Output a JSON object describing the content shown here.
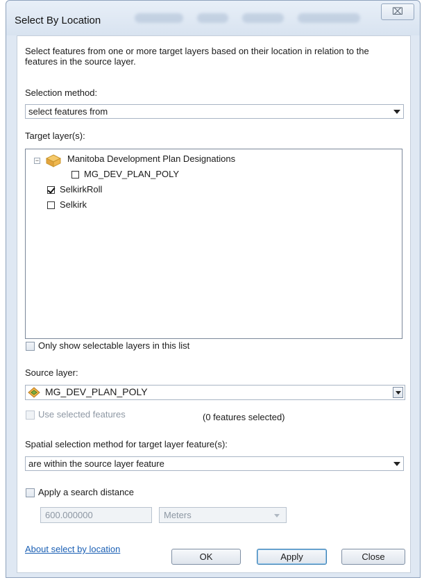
{
  "window": {
    "title": "Select By Location",
    "close_glyph": "⌧"
  },
  "description": "Select features from one or more target layers based on their location in relation to the features in the source layer.",
  "selection_method": {
    "label": "Selection method:",
    "value": "select features from"
  },
  "target_layers": {
    "label": "Target layer(s):",
    "group": {
      "name": "Manitoba Development Plan Designations",
      "expanded": true
    },
    "items": [
      {
        "name": "MG_DEV_PLAN_POLY",
        "checked": false,
        "indent": "child"
      },
      {
        "name": "SelkirkRoll",
        "checked": true,
        "indent": "root"
      },
      {
        "name": "Selkirk",
        "checked": false,
        "indent": "root"
      }
    ]
  },
  "only_selectable": {
    "label": "Only show selectable layers in this list",
    "checked": false
  },
  "source_layer": {
    "label": "Source layer:",
    "value": "MG_DEV_PLAN_POLY",
    "use_selected_label": "Use selected features",
    "features_selected": "(0 features selected)"
  },
  "spatial_method": {
    "label": "Spatial selection method for target layer feature(s):",
    "value": "are within the source layer feature"
  },
  "search_distance": {
    "label": "Apply a search distance",
    "checked": false,
    "distance": "600.000000",
    "unit": "Meters"
  },
  "footer": {
    "about_link": "About select by location",
    "ok": "OK",
    "apply": "Apply",
    "close": "Close"
  },
  "colors": {
    "link": "#1a5fb4",
    "window_frame": "#dfe8f3",
    "default_button_border": "#3c7fb1"
  }
}
